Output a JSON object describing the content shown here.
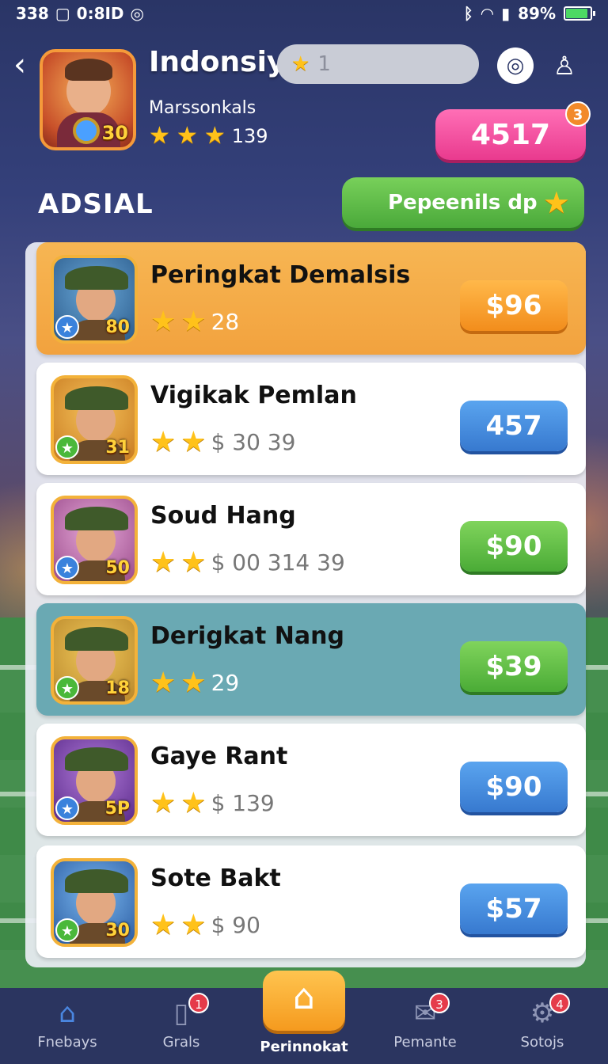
{
  "status_bar": {
    "left_text": "338",
    "time": "0:8ID",
    "battery_text": "89%",
    "battery_level": 0.89
  },
  "header": {
    "player_name": "Indonsiy",
    "rank_value": "1",
    "subtitle": "Marssonkals",
    "star_count": "139",
    "avatar_level": "30",
    "coins": "4517",
    "coins_badge": "3"
  },
  "section": {
    "title": "ADSIAL",
    "promo_label": "Pepeenils dp"
  },
  "rows": [
    {
      "title": "Peringkat Demalsis",
      "meta": "28",
      "price": "$96",
      "level": "80",
      "style": "orange",
      "price_style": "orange"
    },
    {
      "title": "Vigikak Pemlan",
      "meta": "$ 30 39",
      "price": "457",
      "level": "31",
      "style": "white",
      "price_style": "blue"
    },
    {
      "title": "Soud Hang",
      "meta": "$ 00 314 39",
      "price": "$90",
      "level": "50",
      "style": "white",
      "price_style": "green"
    },
    {
      "title": "Derigkat Nang",
      "meta": "29",
      "price": "$39",
      "level": "18",
      "style": "teal",
      "price_style": "green"
    },
    {
      "title": "Gaye Rant",
      "meta": "$ 139",
      "price": "$90",
      "level": "5P",
      "style": "white",
      "price_style": "blue"
    },
    {
      "title": "Sote Bakt",
      "meta": "$ 90",
      "price": "$57",
      "level": "30",
      "style": "white",
      "price_style": "blue"
    }
  ],
  "nav": {
    "items": [
      {
        "label": "Fnebays",
        "icon": "home-icon",
        "badge": ""
      },
      {
        "label": "Grals",
        "icon": "cards-icon",
        "badge": "1"
      },
      {
        "label": "Perinnokat",
        "icon": "house-icon",
        "badge": ""
      },
      {
        "label": "Pemante",
        "icon": "mail-icon",
        "badge": "3"
      },
      {
        "label": "Sotojs",
        "icon": "gear-icon",
        "badge": "4"
      }
    ]
  },
  "colors": {
    "accent_pink": "#e93a8e",
    "accent_green": "#4aab36",
    "accent_blue": "#3779cf",
    "accent_orange": "#f28d1c"
  }
}
